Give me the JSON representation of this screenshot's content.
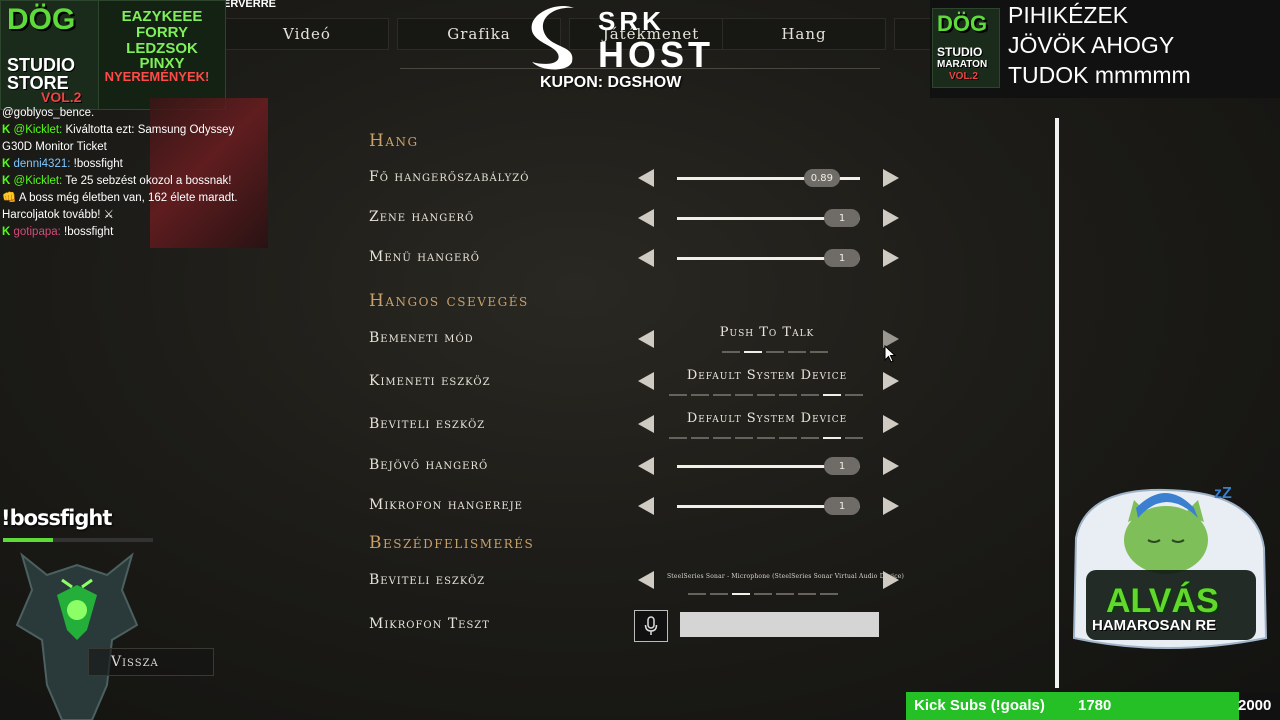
{
  "overlay": {
    "top_left_label": "ERVERRE",
    "store_logo": {
      "title": "DÖG",
      "sub1": "STUDIO",
      "sub2": "STORE",
      "tag": "VOL.2"
    },
    "promo_lines": [
      "EAZYKEEE",
      "FORRY",
      "LEDZSOK",
      "PINXY"
    ],
    "promo_footer": "NYEREMÉNYEK!",
    "sponsor": {
      "line1": "SRK",
      "line2": "HOST",
      "coupon": "KUPON: DGSHOW"
    },
    "marathon_logo": {
      "title": "DÖG",
      "sub1": "STUDIO",
      "sub2": "MARATON",
      "tag": "VOL.2"
    },
    "right_text": [
      "PIHIKÉZEK",
      "JÖVÖK AHOGY",
      "TUDOK mmmmm"
    ],
    "bossfight": "!bossfight",
    "sleep": {
      "title": "ALVÁS",
      "subtitle": "HAMAROSAN RE"
    },
    "subs": {
      "label": "Kick Subs (!goals)",
      "current": "1780",
      "goal": "2000",
      "progress_fraction": 0.89
    }
  },
  "chat": [
    {
      "type": "plain",
      "text": "@goblyos_bence."
    },
    {
      "type": "msg",
      "user": "@Kicklet:",
      "user_class": "user",
      "text": "Kiváltotta ezt: Samsung Odyssey"
    },
    {
      "type": "plain",
      "text": "G30D Monitor Ticket"
    },
    {
      "type": "msg",
      "user": "denni4321:",
      "user_class": "user2",
      "text": "!bossfight"
    },
    {
      "type": "msg",
      "user": "@Kicklet:",
      "user_class": "user",
      "text": "Te 25 sebzést okozol a bossnak!"
    },
    {
      "type": "plain",
      "text": "👊 A boss még életben van, 162 élete maradt."
    },
    {
      "type": "plain",
      "text": "Harcoljatok tovább! ⚔"
    },
    {
      "type": "msg",
      "user": "gotipapa:",
      "user_class": "user3",
      "text": "!bossfight"
    }
  ],
  "tabs": [
    "Videó",
    "Grafika",
    "Játékmenet",
    "Hang"
  ],
  "sections": {
    "hang": "Hang",
    "voice": "Hangos csevegés",
    "speech": "Beszédfelismerés"
  },
  "settings": {
    "master_volume": {
      "label": "Fő hangerőszabályzó",
      "value": "0.89",
      "fraction": 0.89
    },
    "music_volume": {
      "label": "Zene hangerő",
      "value": "1",
      "fraction": 1
    },
    "menu_volume": {
      "label": "Menü hangerő",
      "value": "1",
      "fraction": 1
    },
    "input_mode": {
      "label": "Bemeneti mód",
      "value": "Push To Talk",
      "option_count": 5,
      "selected_index": 1
    },
    "output_device": {
      "label": "Kimeneti eszköz",
      "value": "Default System Device",
      "option_count": 9,
      "selected_index": 7
    },
    "input_device": {
      "label": "Beviteli eszköz",
      "value": "Default System Device",
      "option_count": 9,
      "selected_index": 7
    },
    "incoming_volume": {
      "label": "Bejövő hangerő",
      "value": "1",
      "fraction": 1
    },
    "mic_volume": {
      "label": "Mikrofon hangereje",
      "value": "1",
      "fraction": 1
    },
    "speech_input_device": {
      "label": "Beviteli eszköz",
      "value": "SteelSeries Sonar - Microphone (SteelSeries Sonar Virtual Audio Device)",
      "option_count": 7,
      "selected_index": 2
    },
    "mic_test": {
      "label": "Mikrofon Teszt"
    }
  },
  "back_button": "Vissza"
}
